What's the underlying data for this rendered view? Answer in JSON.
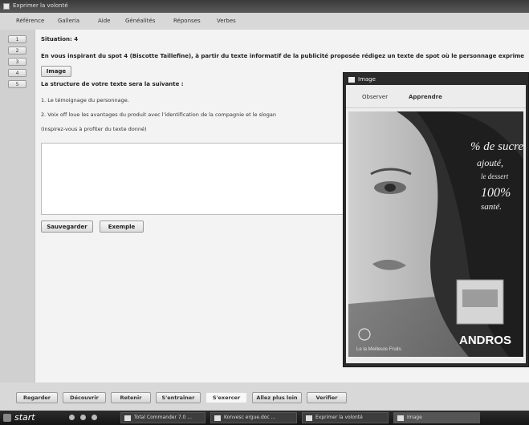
{
  "window": {
    "title": "Exprimer la volonté"
  },
  "menu": [
    "Référence",
    "Galleria",
    "Aide",
    "Généalités",
    "Réponses",
    "Verbes"
  ],
  "left_buttons": [
    "1",
    "2",
    "3",
    "4",
    "5"
  ],
  "content": {
    "situation": "Situation: 4",
    "instruction": "En vous inspirant du spot 4 (Biscotte Taillefine), à partir du texte informatif de la publicité proposée rédigez un texte de spot où le personnage exprime",
    "image_button": "Image",
    "structure_heading": "La structure de votre texte sera la suivante :",
    "structure_items": [
      "1.  Le témoignage du personnage.",
      "2.  Voix off loue les avantages du produit avec l'identification de la compagnie et le slogan",
      "(Inspirez-vous à profiter du texte donné)"
    ],
    "save_button": "Sauvegarder",
    "example_button": "Exemple"
  },
  "bottom_nav": [
    {
      "label": "Regarder",
      "active": false
    },
    {
      "label": "Découvrir",
      "active": false
    },
    {
      "label": "Retenir",
      "active": false
    },
    {
      "label": "S'entraîner",
      "active": false
    },
    {
      "label": "S'exercer",
      "active": true
    },
    {
      "label": "Allez plus loin",
      "active": false
    },
    {
      "label": "Verifier",
      "active": false
    }
  ],
  "image_window": {
    "title": "Image",
    "tabs": [
      "Observer",
      "Apprendre"
    ],
    "ad": {
      "percent_text": "% de sucre",
      "ajoute": "ajouté,",
      "le_dessert": "le dessert",
      "cent": "100%",
      "sante": "santé.",
      "brand": "ANDROS",
      "tagline": "Le la Meilleure Fruits"
    }
  },
  "taskbar": {
    "start": "start",
    "tasks": [
      "Total Commander 7.0 ...",
      "Konvesc ergue.doc ...",
      "Exprimer la volonté",
      "Image"
    ],
    "icons": [
      "start-orb-icon",
      "browser-icon",
      "media-icon",
      "folder-icon"
    ]
  }
}
